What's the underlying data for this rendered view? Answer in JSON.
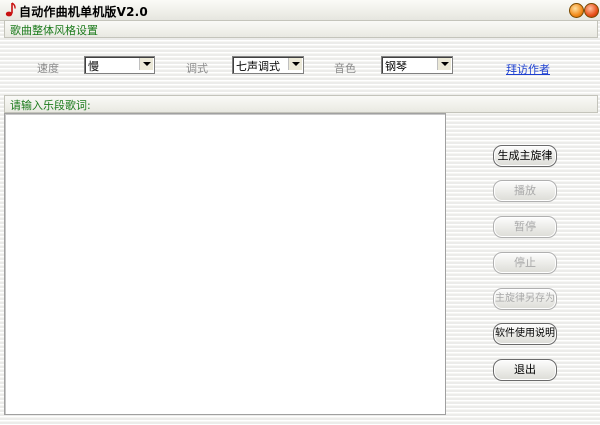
{
  "window": {
    "title": "自动作曲机单机版V2.0",
    "icons": {
      "app": "music-note-icon",
      "minimize": "minimize-icon",
      "close": "close-icon"
    },
    "accent": "#1a7a1a",
    "link_color": "#1c3fd0"
  },
  "style_section": {
    "title": "歌曲整体风格设置",
    "speed": {
      "label": "速度",
      "value": "慢"
    },
    "mode": {
      "label": "调式",
      "value": "七声调式"
    },
    "timbre": {
      "label": "音色",
      "value": "钢琴"
    },
    "visit_author_link": "拜访作者"
  },
  "lyrics_section": {
    "title": "请输入乐段歌词:",
    "text": ""
  },
  "buttons": [
    {
      "label": "生成主旋律",
      "enabled": true
    },
    {
      "label": "播放",
      "enabled": false
    },
    {
      "label": "暂停",
      "enabled": false
    },
    {
      "label": "停止",
      "enabled": false
    },
    {
      "label": "主旋律另存为",
      "enabled": false
    },
    {
      "label": "软件使用说明",
      "enabled": true
    },
    {
      "label": "退出",
      "enabled": true
    }
  ]
}
